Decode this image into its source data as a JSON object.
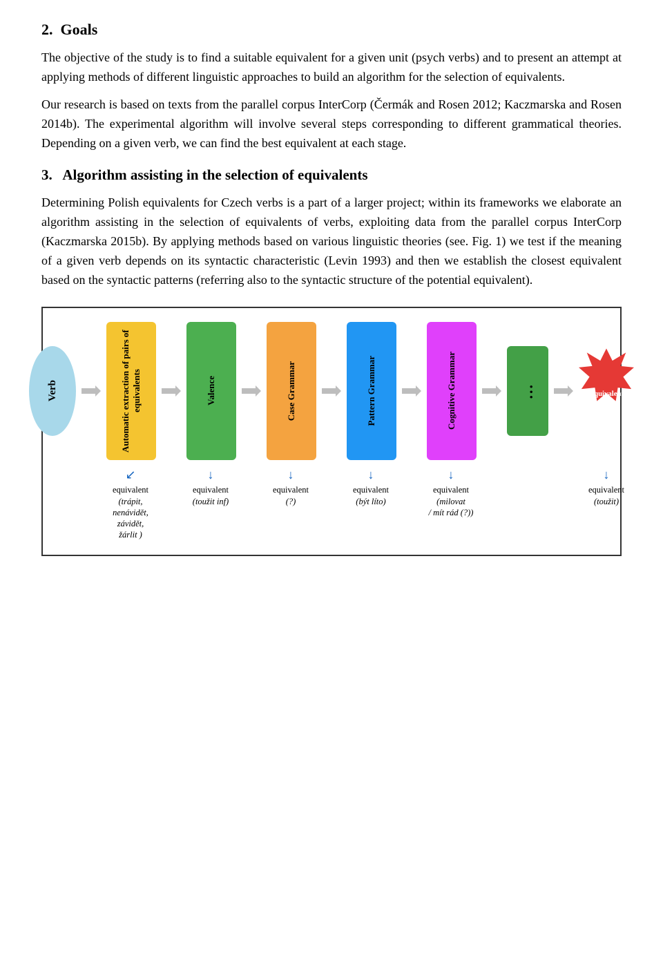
{
  "section2": {
    "heading": "2.  Goals",
    "paragraphs": [
      "The objective of the study is to find a suitable equivalent for a given unit (psych verbs) and to present an attempt at applying methods of different linguistic approaches to build an algorithm for the selection of equivalents.",
      "Our research is based on texts from the parallel corpus InterCorp (Čermák and Rosen 2012; Kaczmarska and Rosen 2014b). The experimental algorithm will involve several steps corresponding to different grammatical theories. Depending on a given verb, we can find the best equivalent at each stage."
    ]
  },
  "section3": {
    "heading": "3.   Algorithm assisting in the selection of equivalents",
    "paragraphs": [
      "Determining Polish equivalents for Czech verbs is a part of a larger project; within its frameworks we elaborate an algorithm assisting in the selection of equivalents of verbs, exploiting data from the parallel corpus InterCorp (Kaczmarska 2015b). By applying methods based on various linguistic theories (see. Fig. 1) we test if the meaning of a given verb depends on its syntactic characteristic (Levin 1993) and then we establish the closest equivalent based on the syntactic patterns (referring also to the syntactic structure of the potential equivalent)."
    ]
  },
  "diagram": {
    "boxes": [
      {
        "id": "verb",
        "label": "Verb",
        "type": "ellipse"
      },
      {
        "id": "automatic",
        "label": "Automatic extraction of pairs of equivalents",
        "type": "rect-yellow"
      },
      {
        "id": "valence",
        "label": "Valence",
        "type": "rect-green"
      },
      {
        "id": "case",
        "label": "Case Grammar",
        "type": "rect-orange"
      },
      {
        "id": "pattern",
        "label": "Pattern Grammar",
        "type": "rect-blue"
      },
      {
        "id": "cognitive",
        "label": "Cognitive Grammar",
        "type": "rect-pink"
      },
      {
        "id": "dots",
        "label": "...",
        "type": "dots"
      },
      {
        "id": "equivalent",
        "label": "Equivalent",
        "type": "starburst"
      }
    ],
    "labels": [
      {
        "id": "verb-label",
        "text": "",
        "sub": ""
      },
      {
        "id": "auto-label",
        "text": "equivalent",
        "sub": "(trápit,\nnenávidět, závidět,\nžarlit )"
      },
      {
        "id": "valence-label",
        "text": "equivalent",
        "sub": "(toužit inf)"
      },
      {
        "id": "case-label",
        "text": "equivalent",
        "sub": "(?)"
      },
      {
        "id": "pattern-label",
        "text": "equivalent",
        "sub": "(být líto)"
      },
      {
        "id": "cognitive-label",
        "text": "equivalent",
        "sub": "(milovat\n/ mít rád (?))"
      },
      {
        "id": "dots-label",
        "text": "",
        "sub": ""
      },
      {
        "id": "equiv-label",
        "text": "equivalent",
        "sub": "(toužit)"
      }
    ]
  }
}
